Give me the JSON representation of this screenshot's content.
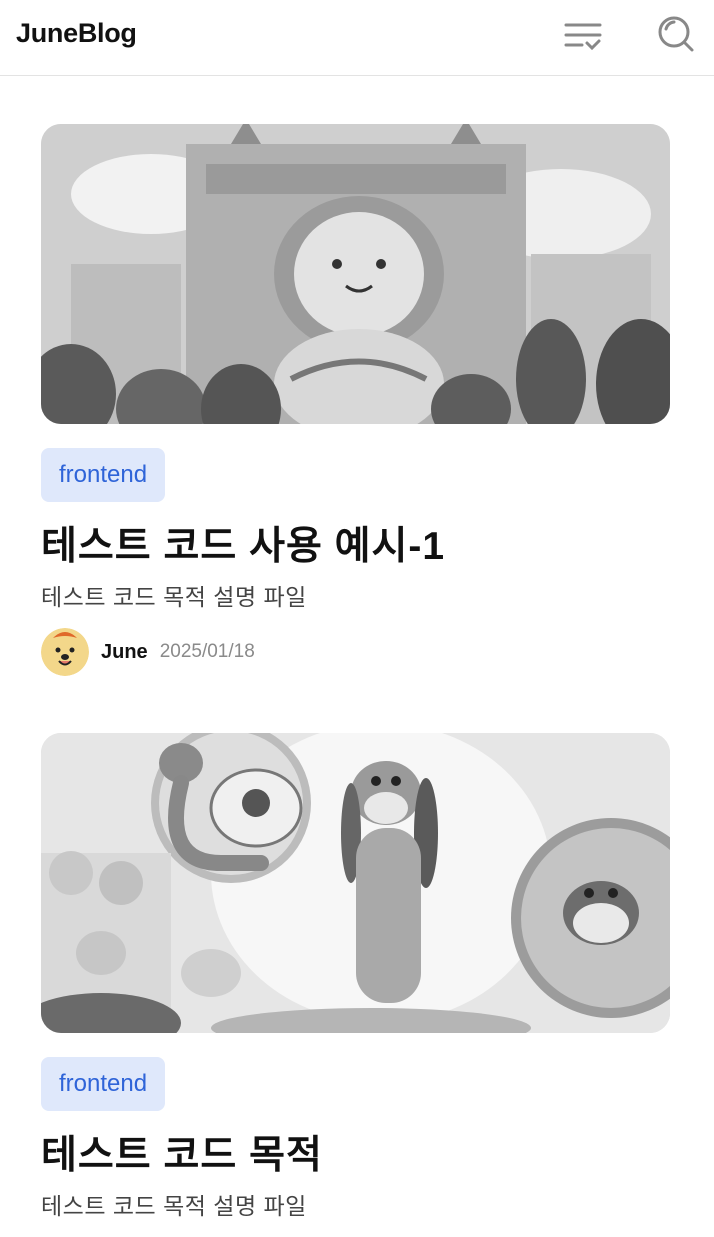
{
  "header": {
    "logo": "JuneBlog",
    "menu_icon": "menu-check-icon",
    "search_icon": "search-icon"
  },
  "posts": [
    {
      "tag": "frontend",
      "title": "테스트 코드 사용 예시-1",
      "description": "테스트 코드 목적 설명 파일",
      "author": "June",
      "date": "2025/01/18",
      "thumbnail": "cat-mascot-building-illustration"
    },
    {
      "tag": "frontend",
      "title": "테스트 코드 목적",
      "description": "테스트 코드 목적 설명 파일",
      "thumbnail": "dog-mascot-stage-illustration"
    }
  ],
  "colors": {
    "tag_bg": "#dfe8fb",
    "tag_text": "#2f64d8",
    "date_text": "#8a8a8a"
  }
}
